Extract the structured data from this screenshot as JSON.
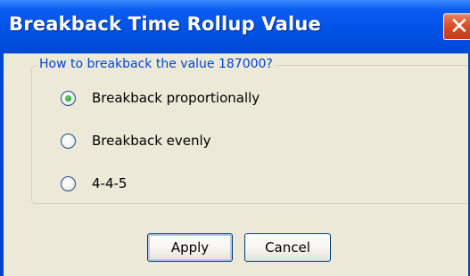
{
  "window": {
    "title": "Breakback Time Rollup Value",
    "close_glyph": "✕"
  },
  "group": {
    "legend": "How to breakback the value 187000?"
  },
  "options": [
    {
      "label": "Breakback proportionally",
      "selected": true
    },
    {
      "label": "Breakback evenly",
      "selected": false
    },
    {
      "label": "4-4-5",
      "selected": false
    }
  ],
  "buttons": {
    "apply": "Apply",
    "cancel": "Cancel"
  },
  "colors": {
    "titlebar": "#0052e6",
    "client": "#ece9d8",
    "legend_text": "#0046d5",
    "close_button": "#d8502a"
  }
}
